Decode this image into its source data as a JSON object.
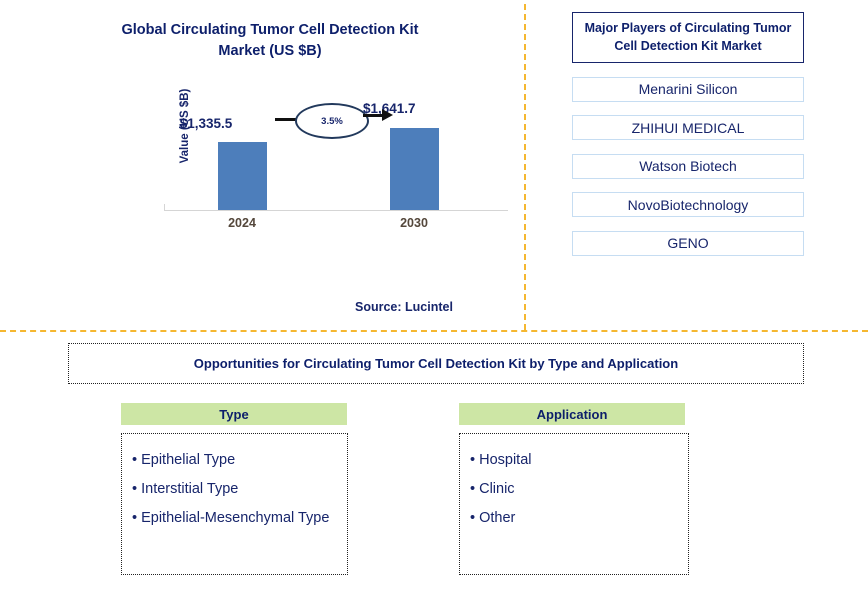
{
  "chart_panel": {
    "title": "Global Circulating Tumor Cell Detection Kit Market (US $B)",
    "title_line1": "Global Circulating Tumor Cell Detection Kit",
    "title_line2": "Market (US $B)",
    "source": "Source: Lucintel"
  },
  "chart_data": {
    "type": "bar",
    "title": "Global Circulating Tumor Cell Detection Kit Market (US $B)",
    "categories": [
      "2024",
      "2030"
    ],
    "values": [
      1335.5,
      1641.7
    ],
    "value_labels": [
      "$1,335.5",
      "$1,641.7"
    ],
    "xlabel": "",
    "ylabel": "Value (US $B)",
    "ylim": [
      0,
      1900
    ],
    "grid": false,
    "legend": "none",
    "annotations": [
      {
        "type": "cagr-ellipse",
        "label": "3.5%",
        "from": "2024",
        "to": "2030"
      }
    ],
    "bar_color": "#4d7ebb",
    "label_color": "#17256b",
    "tick_label_color": "#54473b"
  },
  "players_panel": {
    "header": "Major Players of Circulating Tumor Cell Detection Kit Market",
    "items": [
      "Menarini Silicon",
      "ZHIHUI MEDICAL",
      "Watson Biotech",
      "NovoBiotechnology",
      "GENO"
    ]
  },
  "opportunities": {
    "banner": "Opportunities for Circulating Tumor Cell Detection Kit by Type and Application",
    "columns": [
      {
        "heading": "Type",
        "items": [
          "• Epithelial Type",
          "• Interstitial Type",
          "• Epithelial-Mesenchymal Type"
        ]
      },
      {
        "heading": "Application",
        "items": [
          "• Hospital",
          "• Clinic",
          "• Other"
        ]
      }
    ]
  },
  "colors": {
    "navy": "#17256b",
    "title_navy": "#0d1f6b",
    "bar_blue": "#4d7ebb",
    "divider_orange": "#f5b731",
    "header_green": "#cde6a5",
    "player_border": "#c6ddf2"
  }
}
